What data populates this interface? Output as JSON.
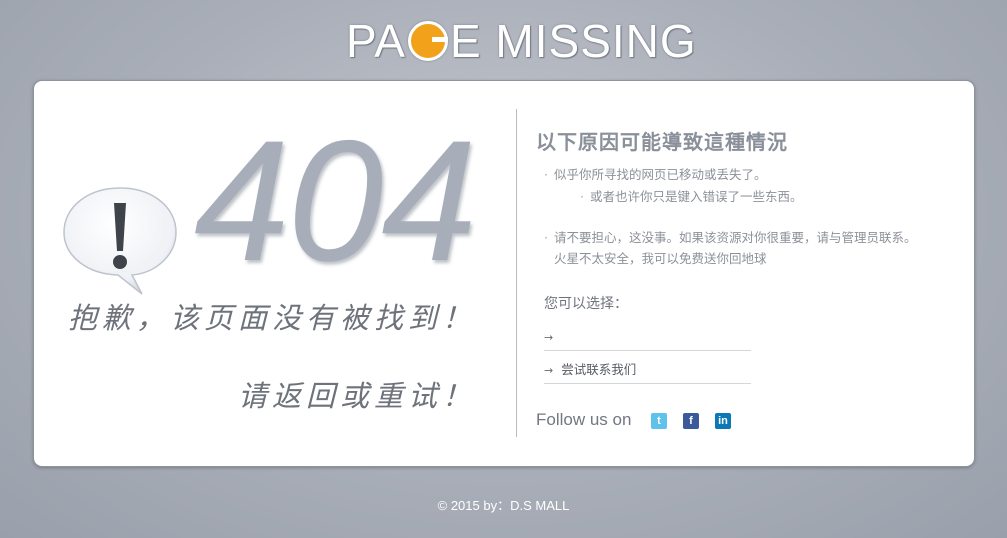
{
  "logo": {
    "text_before": "PA",
    "text_after": "E MISSING"
  },
  "left": {
    "code": "404",
    "apology": "抱歉，该页面没有被找到！",
    "retry": "请返回或重试！"
  },
  "right": {
    "title": "以下原因可能導致這種情況",
    "reasons": [
      {
        "dot": "·",
        "text": "似乎你所寻找的网页已移动或丢失了。"
      },
      {
        "dot": "·",
        "text": "或者也许你只是键入错误了一些东西。"
      },
      {
        "dot": "·",
        "text": "请不要担心，这没事。如果该资源对你很重要，请与管理员联系。"
      },
      {
        "dot": "",
        "text": "火星不太安全，我可以免费送你回地球"
      }
    ],
    "choose_label": "您可以选择：",
    "links": [
      {
        "arrow": "→",
        "label": ""
      },
      {
        "arrow": "→",
        "label": "尝试联系我们"
      }
    ],
    "follow_label": "Follow us on",
    "social": {
      "twitter": "t",
      "facebook": "f",
      "linkedin": "in"
    }
  },
  "footer": {
    "text": "© 2015 by：D.S MALL"
  },
  "colors": {
    "accent": "#f2a21a",
    "background": "#a9aeb8",
    "card": "#ffffff"
  }
}
